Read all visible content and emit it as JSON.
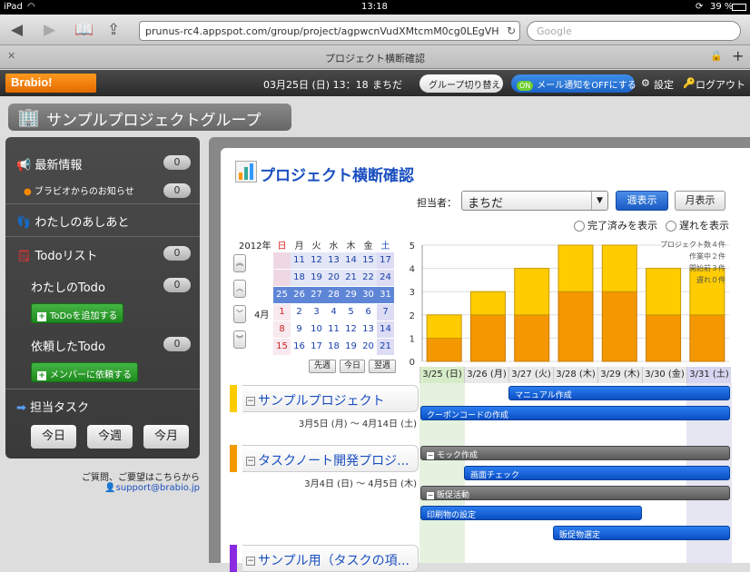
{
  "status": {
    "device": "iPad",
    "time": "13:18",
    "battery": "39 %"
  },
  "browser": {
    "url": "prunus-rc4.appspot.com/group/project/agpwcnVudXMtcmM0cg0LEgVH",
    "search_placeholder": "Google",
    "tab_title": "プロジェクト横断確認"
  },
  "header": {
    "logo": "Brabio!",
    "datetime": "03月25日 (日) 13：18",
    "user": "まちだ",
    "group_switch": "グループ切り替え",
    "mail_toggle_on": "ON",
    "mail_toggle_label": "メール通知をOFFにする",
    "settings": "設定",
    "logout": "ログアウト"
  },
  "page": {
    "group_title": "サンプルプロジェクトグループ",
    "title": "プロジェクト横断確認"
  },
  "sidebar": {
    "news": {
      "label": "最新情報",
      "count": "0"
    },
    "notice": {
      "label": "ブラビオからのお知らせ",
      "count": "0"
    },
    "footprint": {
      "label": "わたしのあしあと"
    },
    "todo": {
      "label": "Todoリスト",
      "count": "0"
    },
    "my_todo": {
      "label": "わたしのTodo",
      "count": "0",
      "button": "ToDoを追加する"
    },
    "req_todo": {
      "label": "依頼したTodo",
      "count": "0",
      "button": "メンバーに依頼する"
    },
    "tasks": {
      "label": "担当タスク",
      "today": "今日",
      "week": "今週",
      "month": "今月"
    },
    "contact_text": "ご質問、ご要望はこちらから",
    "contact_email": "support@brabio.jp"
  },
  "controls": {
    "assignee_label": "担当者：",
    "assignee": "まちだ",
    "week_view": "週表示",
    "month_view": "月表示",
    "show_done": "完了済みを表示",
    "show_late": "遅れを表示"
  },
  "calendar": {
    "year": "2012年",
    "month": "4月",
    "weekdays": [
      "日",
      "月",
      "火",
      "水",
      "木",
      "金",
      "土"
    ],
    "rows": [
      [
        "",
        "11",
        "12",
        "13",
        "14",
        "15",
        "17"
      ],
      [
        "",
        "18",
        "19",
        "20",
        "21",
        "22",
        "24"
      ],
      [
        "25",
        "26",
        "27",
        "28",
        "29",
        "30",
        "31"
      ],
      [
        "1",
        "2",
        "3",
        "4",
        "5",
        "6",
        "7"
      ],
      [
        "8",
        "9",
        "10",
        "11",
        "12",
        "13",
        "14"
      ],
      [
        "15",
        "16",
        "17",
        "18",
        "19",
        "20",
        "21"
      ]
    ],
    "prev_week": "先週",
    "today": "今日",
    "next_week": "翌週"
  },
  "chart_data": {
    "type": "bar",
    "categories": [
      "3/25",
      "3/26",
      "3/27",
      "3/28",
      "3/29",
      "3/30",
      "3/31"
    ],
    "series": [
      {
        "name": "bottom",
        "values": [
          1,
          2,
          2,
          3,
          3,
          2,
          2
        ]
      },
      {
        "name": "top",
        "values": [
          1,
          1,
          2,
          2,
          2,
          2,
          2
        ]
      }
    ],
    "ylim": [
      0,
      5
    ],
    "yticks": [
      "0",
      "1",
      "2",
      "3",
      "4",
      "5"
    ],
    "legend": [
      "プロジェクト数４件",
      "作業中２件",
      "開始前３件",
      "遅れ０件"
    ],
    "colors": {
      "bottom": "#f39800",
      "top": "#ffcc00"
    }
  },
  "gantt": {
    "days": [
      "3/25 (日)",
      "3/26 (月)",
      "3/27 (火)",
      "3/28 (木)",
      "3/29 (木)",
      "3/30 (金)",
      "3/31 (土)"
    ],
    "projects": [
      {
        "name": "サンプルプロジェクト",
        "dates": "3月5日 (月) 〜 4月14日 (土)",
        "color": "#ffcc00"
      },
      {
        "name": "タスクノート開発プロジ...",
        "dates": "3月4日 (日) 〜 4月5日 (木)",
        "color": "#f39800"
      },
      {
        "name": "サンプル用（タスクの項...",
        "dates": "",
        "color": "#8a2be2"
      }
    ],
    "tasks": {
      "manual": "マニュアル作成",
      "coupon": "クーポンコードの作成",
      "mock": "モック作成",
      "screen": "画面チェック",
      "promo": "販促活動",
      "print": "印刷物の設定",
      "goods": "販促物選定"
    }
  }
}
